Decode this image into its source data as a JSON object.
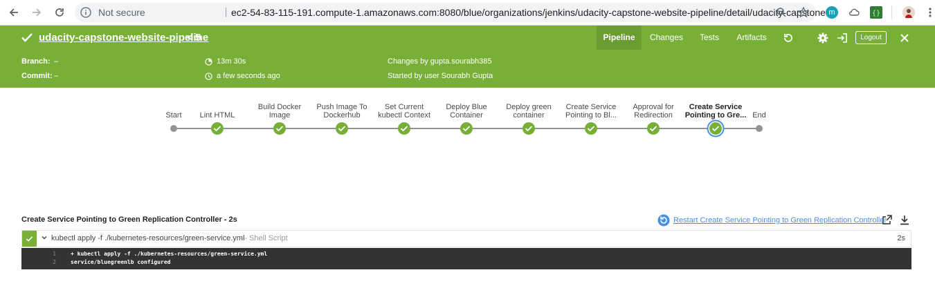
{
  "browser": {
    "security_label": "Not secure",
    "url": "ec2-54-83-115-191.compute-1.amazonaws.com:8080/blue/organizations/jenkins/udacity-capstone-website-pipeline/detail/udacity-capstone..."
  },
  "header": {
    "run_name": "udacity-capstone-website-pipeline",
    "separator": "<",
    "run_number": "5",
    "tabs": [
      {
        "label": "Pipeline",
        "active": true
      },
      {
        "label": "Changes",
        "active": false
      },
      {
        "label": "Tests",
        "active": false
      },
      {
        "label": "Artifacts",
        "active": false
      }
    ],
    "logout_label": "Logout"
  },
  "summary": {
    "branch_label": "Branch:",
    "branch_value": "–",
    "commit_label": "Commit:",
    "commit_value": "–",
    "duration": "13m 30s",
    "ago": "a few seconds ago",
    "changes": "Changes by gupta.sourabh385",
    "started": "Started by user Sourabh Gupta"
  },
  "pipeline": {
    "stages": [
      {
        "line1": "",
        "line2": "Start",
        "status": "start"
      },
      {
        "line1": "",
        "line2": "Lint HTML",
        "status": "success"
      },
      {
        "line1": "Build Docker",
        "line2": "Image",
        "status": "success"
      },
      {
        "line1": "Push Image To",
        "line2": "Dockerhub",
        "status": "success"
      },
      {
        "line1": "Set Current",
        "line2": "kubectl Context",
        "status": "success"
      },
      {
        "line1": "Deploy Blue",
        "line2": "Container",
        "status": "success"
      },
      {
        "line1": "Deploy green",
        "line2": "container",
        "status": "success"
      },
      {
        "line1": "Create Service",
        "line2": "Pointing to Bl...",
        "status": "success"
      },
      {
        "line1": "Approval for",
        "line2": "Redirection",
        "status": "success"
      },
      {
        "line1": "Create Service",
        "line2": "Pointing to Gre...",
        "status": "selected"
      },
      {
        "line1": "",
        "line2": "End",
        "status": "end"
      }
    ]
  },
  "log": {
    "title": "Create Service Pointing to Green Replication Controller - 2s",
    "restart_label": "Restart Create Service Pointing to Green Replication Controller",
    "step": {
      "command": "kubectl apply -f ./kubernetes-resources/green-service.yml",
      "type": "— Shell Script",
      "duration": "2s"
    },
    "lines": [
      {
        "num": "1",
        "text": "+ kubectl apply -f ./kubernetes-resources/green-service.yml"
      },
      {
        "num": "2",
        "text": "service/bluegreenlb configured"
      }
    ]
  },
  "colors": {
    "success_green": "#78b037",
    "active_tab": "#6a9c31",
    "selected_ring": "#4a90e2",
    "link_blue": "#4a90e2"
  }
}
